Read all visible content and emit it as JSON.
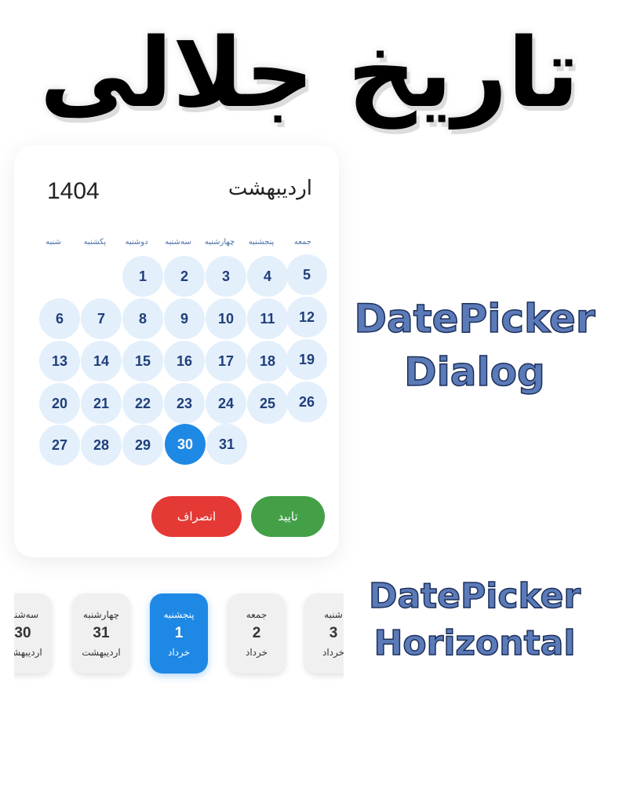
{
  "title": "تاریخ جلالی",
  "dialog": {
    "year": "1404",
    "month": "اردیبهشت",
    "weekdays": [
      "جمعه",
      "پنجشنبه",
      "چهارشنبه",
      "سه‌شنبه",
      "دوشنبه",
      "یکشنبه",
      "شنبه"
    ],
    "days": [
      "1",
      "2",
      "3",
      "4",
      "5",
      "6",
      "7",
      "8",
      "9",
      "10",
      "11",
      "12",
      "13",
      "14",
      "15",
      "16",
      "17",
      "18",
      "19",
      "20",
      "21",
      "22",
      "23",
      "24",
      "25",
      "26",
      "27",
      "28",
      "29",
      "30",
      "31"
    ],
    "selected_day": "30",
    "confirm_label": "تایید",
    "cancel_label": "انصراف"
  },
  "labels": {
    "dialog_line1": "DatePicker",
    "dialog_line2": "Dialog",
    "horizontal_line1": "DatePicker",
    "horizontal_line2": "Horizontal"
  },
  "horizontal": {
    "cards": [
      {
        "weekday": "سه‌شنبه",
        "day": "30",
        "month": "اردیبهشت",
        "selected": false
      },
      {
        "weekday": "چهارشنبه",
        "day": "31",
        "month": "اردیبهشت",
        "selected": false
      },
      {
        "weekday": "پنجشنبه",
        "day": "1",
        "month": "خرداد",
        "selected": true
      },
      {
        "weekday": "جمعه",
        "day": "2",
        "month": "خرداد",
        "selected": false
      },
      {
        "weekday": "شنبه",
        "day": "3",
        "month": "خرداد",
        "selected": false
      }
    ]
  },
  "colors": {
    "selected": "#1e88e5",
    "day_bg": "#e3effb",
    "confirm": "#43a047",
    "cancel": "#e53935",
    "label": "#5b7ab8"
  }
}
